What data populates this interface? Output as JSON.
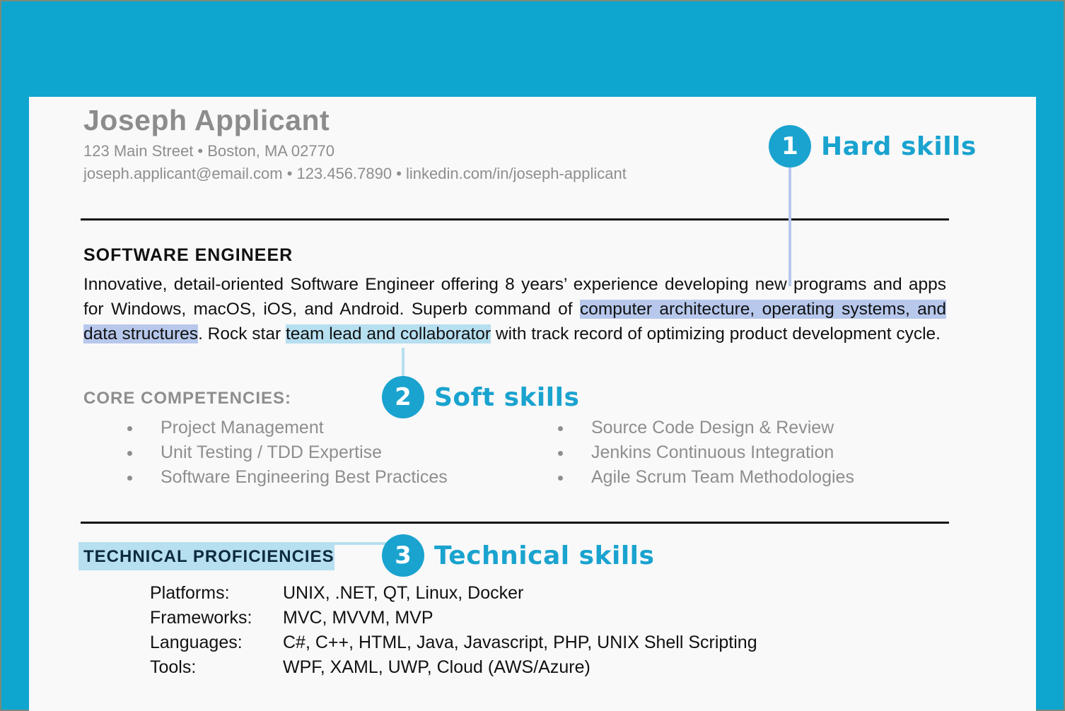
{
  "colors": {
    "background": "#0ea5cf",
    "accent": "#1aa3cf",
    "hard_skill_highlight": "#b7c8ec",
    "soft_skill_highlight": "#b6dff0"
  },
  "header": {
    "name": "Joseph Applicant",
    "address": "123 Main Street • Boston, MA 02770",
    "contact_line": "joseph.applicant@email.com • 123.456.7890 • linkedin.com/in/joseph-applicant"
  },
  "summary": {
    "title": "SOFTWARE ENGINEER",
    "part1": "Innovative, detail-oriented Software Engineer offering 8 years’ experience developing new programs and apps for Windows, macOS, iOS, and Android. Superb command of ",
    "hard_skills_highlight": "computer architecture, operating systems, and data structures",
    "part2": ". Rock star ",
    "soft_skills_highlight": "team lead and collaborator",
    "part3": " with track record of optimizing product development cycle."
  },
  "core_competencies": {
    "title": "CORE COMPETENCIES:",
    "left": [
      "Project Management",
      "Unit Testing / TDD Expertise",
      "Software Engineering Best Practices"
    ],
    "right": [
      "Source Code Design & Review",
      "Jenkins Continuous Integration",
      "Agile Scrum Team Methodologies"
    ]
  },
  "technical": {
    "title": "TECHNICAL PROFICIENCIES",
    "rows": [
      {
        "label": "Platforms:",
        "value": "UNIX, .NET, QT, Linux, Docker"
      },
      {
        "label": "Frameworks:",
        "value": "MVC, MVVM, MVP"
      },
      {
        "label": "Languages:",
        "value": "C#, C++, HTML, Java, Javascript, PHP, UNIX Shell Scripting"
      },
      {
        "label": "Tools:",
        "value": "WPF, XAML, UWP, Cloud (AWS/Azure)"
      }
    ]
  },
  "callouts": [
    {
      "number": "1",
      "label": "Hard skills"
    },
    {
      "number": "2",
      "label": "Soft skills"
    },
    {
      "number": "3",
      "label": "Technical skills"
    }
  ]
}
